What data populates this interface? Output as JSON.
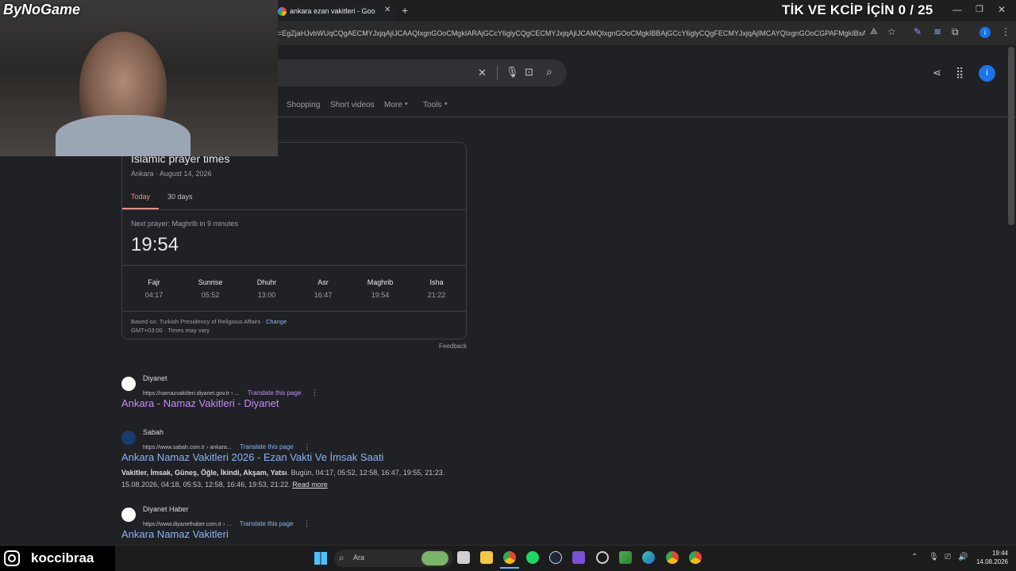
{
  "browser": {
    "tab_title": "ankara ezan vakitleri - Google",
    "new_tab_symbol": "+",
    "url": "=EgZjaHJvbWUqCQgAECMYJxjqAjIJCAAQIxgnGOoCMgkIARAjGCcY6glyCQgCECMYJxjqAjIJCAMQIxgnGOoCMgkIBBAjGCcY6glyCQgFECMYJxjqAjIMCAYQIxgnGOoCGPAFMgkIBxAj..."
  },
  "overlay": {
    "brand": "ByNoGame",
    "counter_title": "TİK VE KCİP İÇİN 0 / 25",
    "instagram_handle": "koccibraa"
  },
  "google": {
    "nav": [
      "Shopping",
      "Short videos",
      "More",
      "Tools"
    ],
    "card": {
      "title": "Islamic prayer times",
      "subtitle": "Ankara · August 14, 2026",
      "tabs": [
        "Today",
        "30 days"
      ],
      "next_prayer": "Next prayer: Maghrib in 9 minutes",
      "big_time": "19:54",
      "prayers": [
        {
          "name": "Fajr",
          "time": "04:17"
        },
        {
          "name": "Sunrise",
          "time": "05:52"
        },
        {
          "name": "Dhuhr",
          "time": "13:00"
        },
        {
          "name": "Asr",
          "time": "16:47"
        },
        {
          "name": "Maghrib",
          "time": "19:54"
        },
        {
          "name": "Isha",
          "time": "21:22"
        }
      ],
      "source": "Based on: Turkish Presidency of Religious Affairs ·",
      "change": "Change",
      "tz": "GMT+03:00 · Times may vary",
      "feedback": "Feedback"
    },
    "results": [
      {
        "site": "Diyanet",
        "url": "https://namazvakitleri.diyanet.gov.tr › ...",
        "translate": "Translate this page",
        "title": "Ankara - Namaz Vakitleri - Diyanet"
      },
      {
        "site": "Sabah",
        "url": "https://www.sabah.com.tr › ankara...",
        "translate": "Translate this page",
        "title": "Ankara Namaz Vakitleri 2026 - Ezan Vakti Ve İmsak Saati",
        "snippet_bold": "Vakitler, İmsak, Güneş, Öğle, İkindi, Akşam, Yatsı",
        "snippet": ". Bugün, 04:17, 05:52, 12:58, 16:47, 19:55, 21:23. 15.08.2026, 04:18, 05:53, 12:58, 16:46, 19:53, 21:22.",
        "read_more": "Read more"
      },
      {
        "site": "Diyanet Haber",
        "url": "https://www.diyanethaber.com.tr › ...",
        "translate": "Translate this page",
        "title": "Ankara Namaz Vakitleri"
      }
    ]
  },
  "taskbar": {
    "search_placeholder": "Ara",
    "time": "19:44",
    "date": "14.08.2026"
  },
  "colors": {
    "accent_red": "#f28b82",
    "link_blue": "#8ab4f8",
    "visited_purple": "#c58af9"
  }
}
